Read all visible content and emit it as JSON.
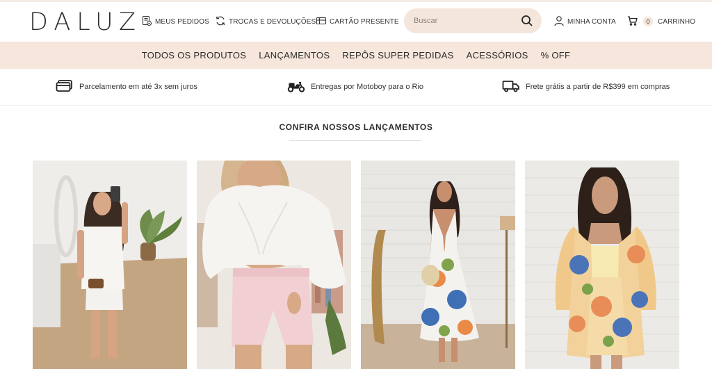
{
  "brand": {
    "logo_text": "DALUZ"
  },
  "header": {
    "links": {
      "pedidos": "MEUS PEDIDOS",
      "trocas": "TROCAS E DEVOLUÇÕES",
      "cartao": "CARTÃO PRESENTE",
      "conta": "MINHA CONTA",
      "carrinho": "CARRINHO"
    },
    "search": {
      "placeholder": "Buscar",
      "value": ""
    },
    "cart_count": "0"
  },
  "nav": {
    "items": [
      "TODOS OS PRODUTOS",
      "LANÇAMENTOS",
      "REPÔS SUPER PEDIDAS",
      "ACESSÓRIOS",
      "% OFF"
    ]
  },
  "benefits": [
    {
      "icon": "credit-card-icon",
      "text": "Parcelamento em até 3x sem juros"
    },
    {
      "icon": "motorcycle-icon",
      "text": "Entregas por Motoboy para o Rio"
    },
    {
      "icon": "truck-icon",
      "text": "Frete grátis a partir de R$399 em compras"
    }
  ],
  "section": {
    "title": "CONFIRA NOSSOS LANÇAMENTOS"
  },
  "colors": {
    "accent": "#f6e6dc",
    "search_bg": "#f5e6dc",
    "text": "#2d2d2d"
  }
}
